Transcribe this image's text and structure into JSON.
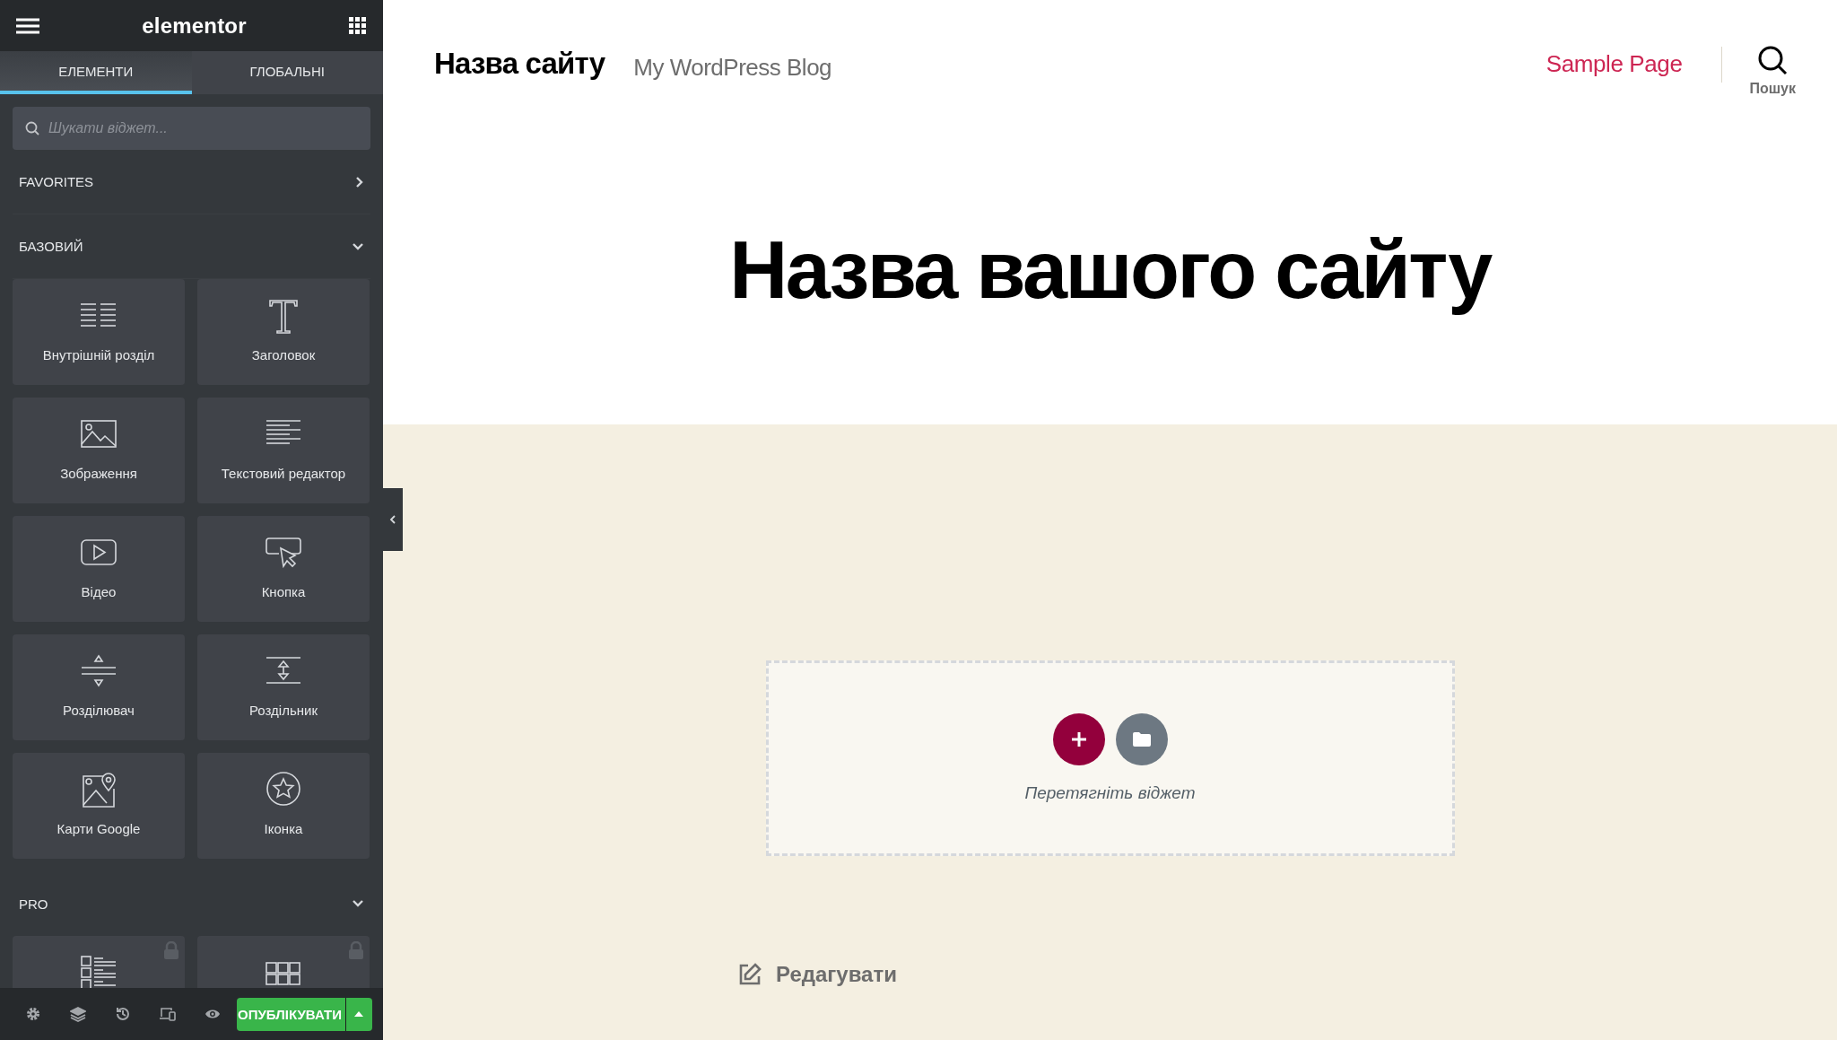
{
  "editor": {
    "logo": "elementor",
    "tabs": [
      {
        "label": "ЕЛЕМЕНТИ",
        "selected": true
      },
      {
        "label": "ГЛОБАЛЬНІ",
        "selected": false
      }
    ],
    "search": {
      "placeholder": "Шукати віджет..."
    },
    "categories": [
      {
        "title": "FAVORITES",
        "expanded": false
      },
      {
        "title": "БАЗОВИЙ",
        "expanded": true,
        "widgets": [
          {
            "kind": "inner-section",
            "label": "Внутрішній розділ",
            "locked": false
          },
          {
            "kind": "heading",
            "label": "Заголовок",
            "locked": false
          },
          {
            "kind": "image",
            "label": "Зображення",
            "locked": false
          },
          {
            "kind": "text-editor",
            "label": "Текстовий редактор",
            "locked": false
          },
          {
            "kind": "video",
            "label": "Відео",
            "locked": false
          },
          {
            "kind": "button",
            "label": "Кнопка",
            "locked": false
          },
          {
            "kind": "divider",
            "label": "Розділювач",
            "locked": false
          },
          {
            "kind": "spacer",
            "label": "Роздільник",
            "locked": false
          },
          {
            "kind": "map",
            "label": "Карти Google",
            "locked": false
          },
          {
            "kind": "icon",
            "label": "Іконка",
            "locked": false
          }
        ]
      },
      {
        "title": "PRO",
        "expanded": true,
        "widgets": [
          {
            "kind": "posts",
            "locked": true
          },
          {
            "kind": "portfolio",
            "locked": true
          }
        ]
      }
    ],
    "publish": {
      "label": "ОПУБЛІКУВАТИ"
    }
  },
  "site": {
    "title": "Назва сайту",
    "tagline": "My WordPress Blog",
    "nav": [
      "Sample Page"
    ],
    "search_label": "Пошук",
    "heading": "Назва вашого сайту",
    "drop_zone": {
      "hint": "Перетягніть віджет"
    },
    "edit_link": "Редагувати"
  }
}
